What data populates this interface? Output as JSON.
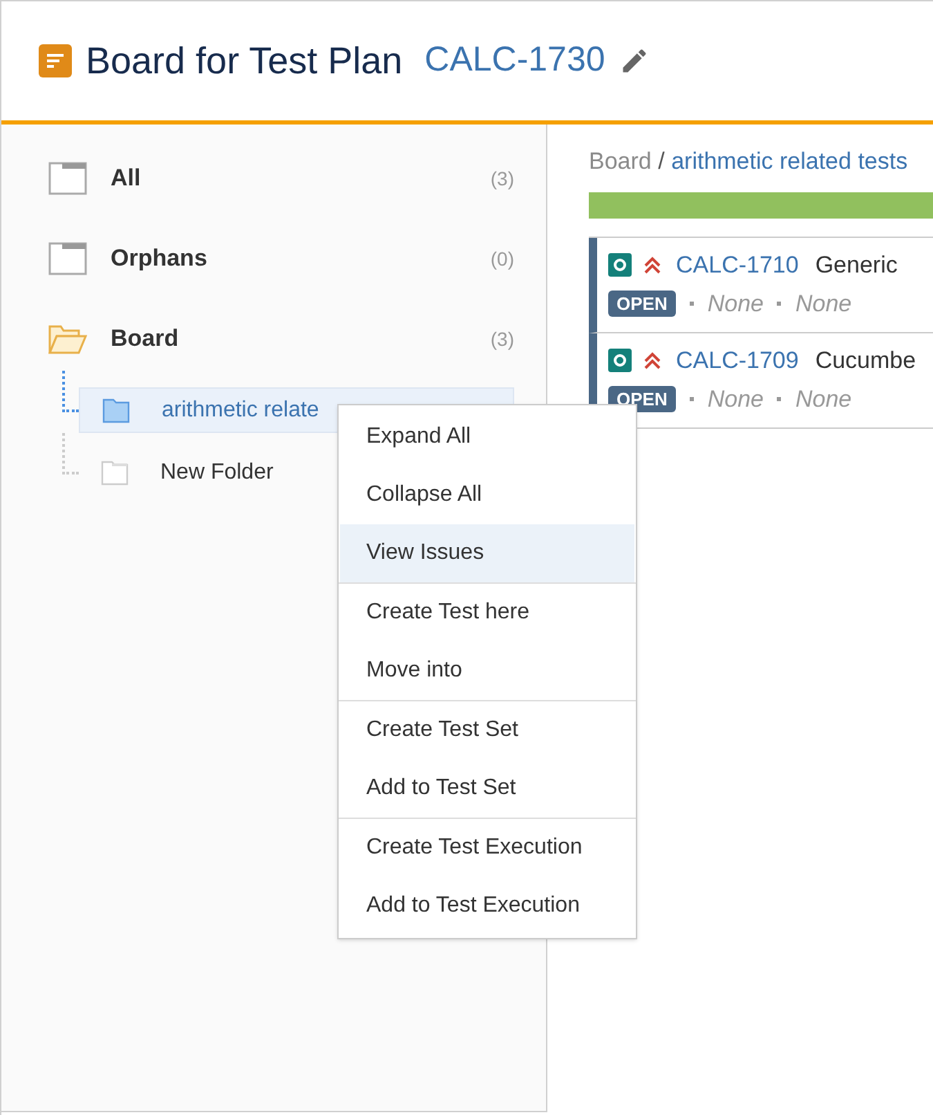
{
  "header": {
    "title": "Board for Test Plan",
    "issue_key": "CALC-1730"
  },
  "tree": [
    {
      "label": "All",
      "count": "(3)",
      "expanded": false,
      "selected": false
    },
    {
      "label": "Orphans",
      "count": "(0)",
      "expanded": false,
      "selected": false
    },
    {
      "label": "Board",
      "count": "(3)",
      "expanded": true,
      "selected": false,
      "children": [
        {
          "label": "arithmetic relate",
          "selected": true
        },
        {
          "label": "New Folder",
          "selected": false
        }
      ]
    }
  ],
  "breadcrumb": {
    "root": "Board",
    "separator": "/",
    "folder": "arithmetic related tests"
  },
  "progress": {
    "level": 1
  },
  "issues": [
    {
      "key": "CALC-1710",
      "summary": "Generic",
      "status": "OPEN",
      "field_1": "None",
      "field_2": "None"
    },
    {
      "key": "CALC-1709",
      "summary": "Cucumbe",
      "status": "OPEN",
      "field_1": "None",
      "field_2": "None"
    }
  ],
  "context_menu": {
    "groups": [
      [
        {
          "label": "Expand All",
          "selected": false
        },
        {
          "label": "Collapse All",
          "selected": false
        },
        {
          "label": "View Issues",
          "selected": true
        }
      ],
      [
        {
          "label": "Create Test here",
          "selected": false
        },
        {
          "label": "Move into",
          "selected": false
        }
      ],
      [
        {
          "label": "Create Test Set",
          "selected": false
        },
        {
          "label": "Add to Test Set",
          "selected": false
        }
      ],
      [
        {
          "label": "Create Test Execution",
          "selected": false
        },
        {
          "label": "Add to Test Execution",
          "selected": false
        }
      ]
    ]
  }
}
